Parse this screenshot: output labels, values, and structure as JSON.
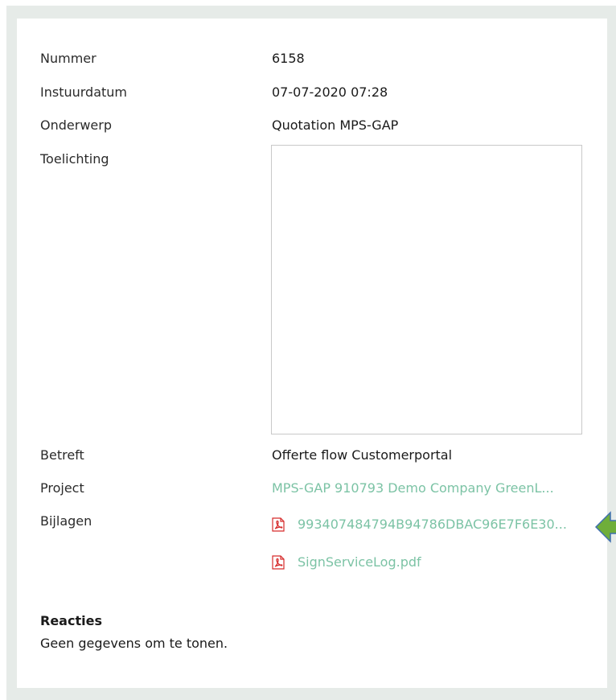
{
  "fields": {
    "nummer": {
      "label": "Nummer",
      "value": "6158"
    },
    "instuurdatum": {
      "label": "Instuurdatum",
      "value": "07-07-2020 07:28"
    },
    "onderwerp": {
      "label": "Onderwerp",
      "value": "Quotation MPS-GAP"
    },
    "toelichting": {
      "label": "Toelichting",
      "value": ""
    },
    "betreft": {
      "label": "Betreft",
      "value": "Offerte flow Customerportal"
    },
    "project": {
      "label": "Project",
      "value": "MPS-GAP 910793 Demo Company GreenL..."
    },
    "bijlagen": {
      "label": "Bijlagen"
    }
  },
  "attachments": [
    {
      "name": "993407484794B94786DBAC96E7F6E30...",
      "icon": "pdf-icon"
    },
    {
      "name": "SignServiceLog.pdf",
      "icon": "pdf-icon"
    }
  ],
  "reacties": {
    "heading": "Reacties",
    "empty_text": "Geen gegevens om te tonen."
  },
  "colors": {
    "link": "#7cc3a5",
    "frame": "#e6ebe8",
    "pdf_red": "#d62b2b",
    "arrow": "#6fae3a"
  },
  "annotation": {
    "icon": "arrow-left-icon"
  }
}
